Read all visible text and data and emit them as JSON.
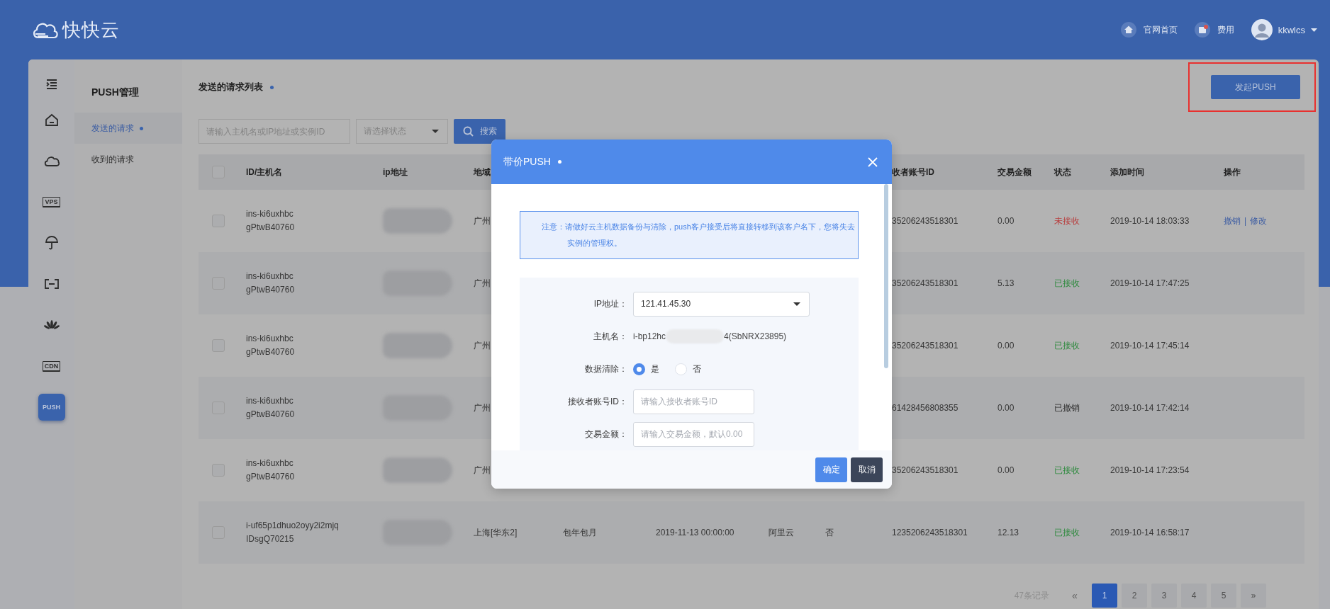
{
  "header": {
    "logo_text": "快快云",
    "links": [
      {
        "label": "官网首页"
      },
      {
        "label": "费用"
      }
    ],
    "user": {
      "name": "kkwlcs"
    }
  },
  "rail": [
    {
      "selected": false
    },
    {
      "selected": false
    },
    {
      "selected": false
    },
    {
      "label": "VPS",
      "selected": false
    },
    {
      "selected": false
    },
    {
      "selected": false
    },
    {
      "selected": false
    },
    {
      "label": "CDN",
      "selected": false
    },
    {
      "label": "PUSH",
      "selected": true
    }
  ],
  "submenu": {
    "title": "PUSH管理",
    "items": [
      {
        "label": "发送的请求",
        "selected": true
      },
      {
        "label": "收到的请求",
        "selected": false
      }
    ]
  },
  "page": {
    "title": "发送的请求列表",
    "primary_button": "发起PUSH"
  },
  "filters": {
    "search": {
      "placeholder": "请输入主机名或IP地址或实例ID"
    },
    "status_select": {
      "placeholder": "请选择状态"
    },
    "search_button": "搜索"
  },
  "table": {
    "header_checkbox": {
      "checked": false
    },
    "columns": [
      "ID/主机名",
      "ip地址",
      "地域",
      "收者账号ID",
      "交易金额",
      "状态",
      "添加时间",
      "操作"
    ],
    "rows": [
      {
        "checked": false,
        "id": "ins-ki6uxhbc",
        "hostname": "gPtwB40760",
        "region": "广州",
        "receiver_id": "35206243518301",
        "amount": "0.00",
        "status": {
          "text": "未接收",
          "kind": "pending"
        },
        "added": "2019-10-14 18:03:33",
        "actions": {
          "items": [
            "撤销",
            "修改"
          ],
          "separator": "|"
        }
      },
      {
        "checked": false,
        "id": "ins-ki6uxhbc",
        "hostname": "gPtwB40760",
        "region": "广州",
        "receiver_id": "35206243518301",
        "amount": "5.13",
        "status": {
          "text": "已接收",
          "kind": "accepted"
        },
        "added": "2019-10-14 17:47:25"
      },
      {
        "checked": false,
        "id": "ins-ki6uxhbc",
        "hostname": "gPtwB40760",
        "region": "广州",
        "receiver_id": "35206243518301",
        "amount": "0.00",
        "status": {
          "text": "已接收",
          "kind": "accepted"
        },
        "added": "2019-10-14 17:45:14"
      },
      {
        "checked": false,
        "id": "ins-ki6uxhbc",
        "hostname": "gPtwB40760",
        "region": "广州",
        "receiver_id": "61428456808355",
        "amount": "0.00",
        "status": {
          "text": "已撤销",
          "kind": "revoked"
        },
        "added": "2019-10-14 17:42:14"
      },
      {
        "checked": false,
        "id": "ins-ki6uxhbc",
        "hostname": "gPtwB40760",
        "region": "广州",
        "receiver_id": "35206243518301",
        "amount": "0.00",
        "status": {
          "text": "已接收",
          "kind": "accepted"
        },
        "added": "2019-10-14 17:23:54"
      },
      {
        "checked": false,
        "id": "i-uf65p1dhuo2oyy2i2mjq",
        "hostname": "IDsgQ70215",
        "region": "上海[华东2]",
        "billing": "包年包月",
        "expiry": "2019-11-13 00:00:00",
        "platform": "阿里云",
        "data_clear": "否",
        "receiver_id": "1235206243518301",
        "amount": "12.13",
        "status": {
          "text": "已接收",
          "kind": "accepted"
        },
        "added": "2019-10-14 16:58:17"
      }
    ]
  },
  "pagination": {
    "total": "47条记录",
    "prev": {
      "label": "«",
      "disabled": true
    },
    "pages": [
      {
        "label": "1",
        "selected": true
      },
      {
        "label": "2",
        "selected": false
      },
      {
        "label": "3",
        "selected": false
      },
      {
        "label": "4",
        "selected": false
      },
      {
        "label": "5",
        "selected": false
      }
    ],
    "next": {
      "label": "»",
      "disabled": false
    }
  },
  "modal": {
    "title": "带价PUSH",
    "notice": "注意：请做好云主机数据备份与清除，push客户接受后将直接转移到该客户名下，您将失去实例的管理权。",
    "fields": [
      {
        "kind": "select",
        "label": "IP地址：",
        "value": "121.41.45.30"
      },
      {
        "kind": "text",
        "label": "主机名：",
        "value_start": "i-bp12hc",
        "value_end": "4(SbNRX23895)"
      },
      {
        "kind": "radio",
        "label": "数据清除：",
        "options": [
          {
            "label": "是",
            "selected": true
          },
          {
            "label": "否",
            "selected": false
          }
        ]
      },
      {
        "kind": "input",
        "label": "接收者账号ID：",
        "placeholder": "请输入接收者账号ID"
      },
      {
        "kind": "input",
        "label": "交易金额：",
        "placeholder": "请输入交易金额，默认0.00"
      }
    ],
    "buttons": [
      {
        "label": "确定",
        "kind": "primary"
      },
      {
        "label": "取消",
        "kind": "secondary"
      }
    ]
  }
}
